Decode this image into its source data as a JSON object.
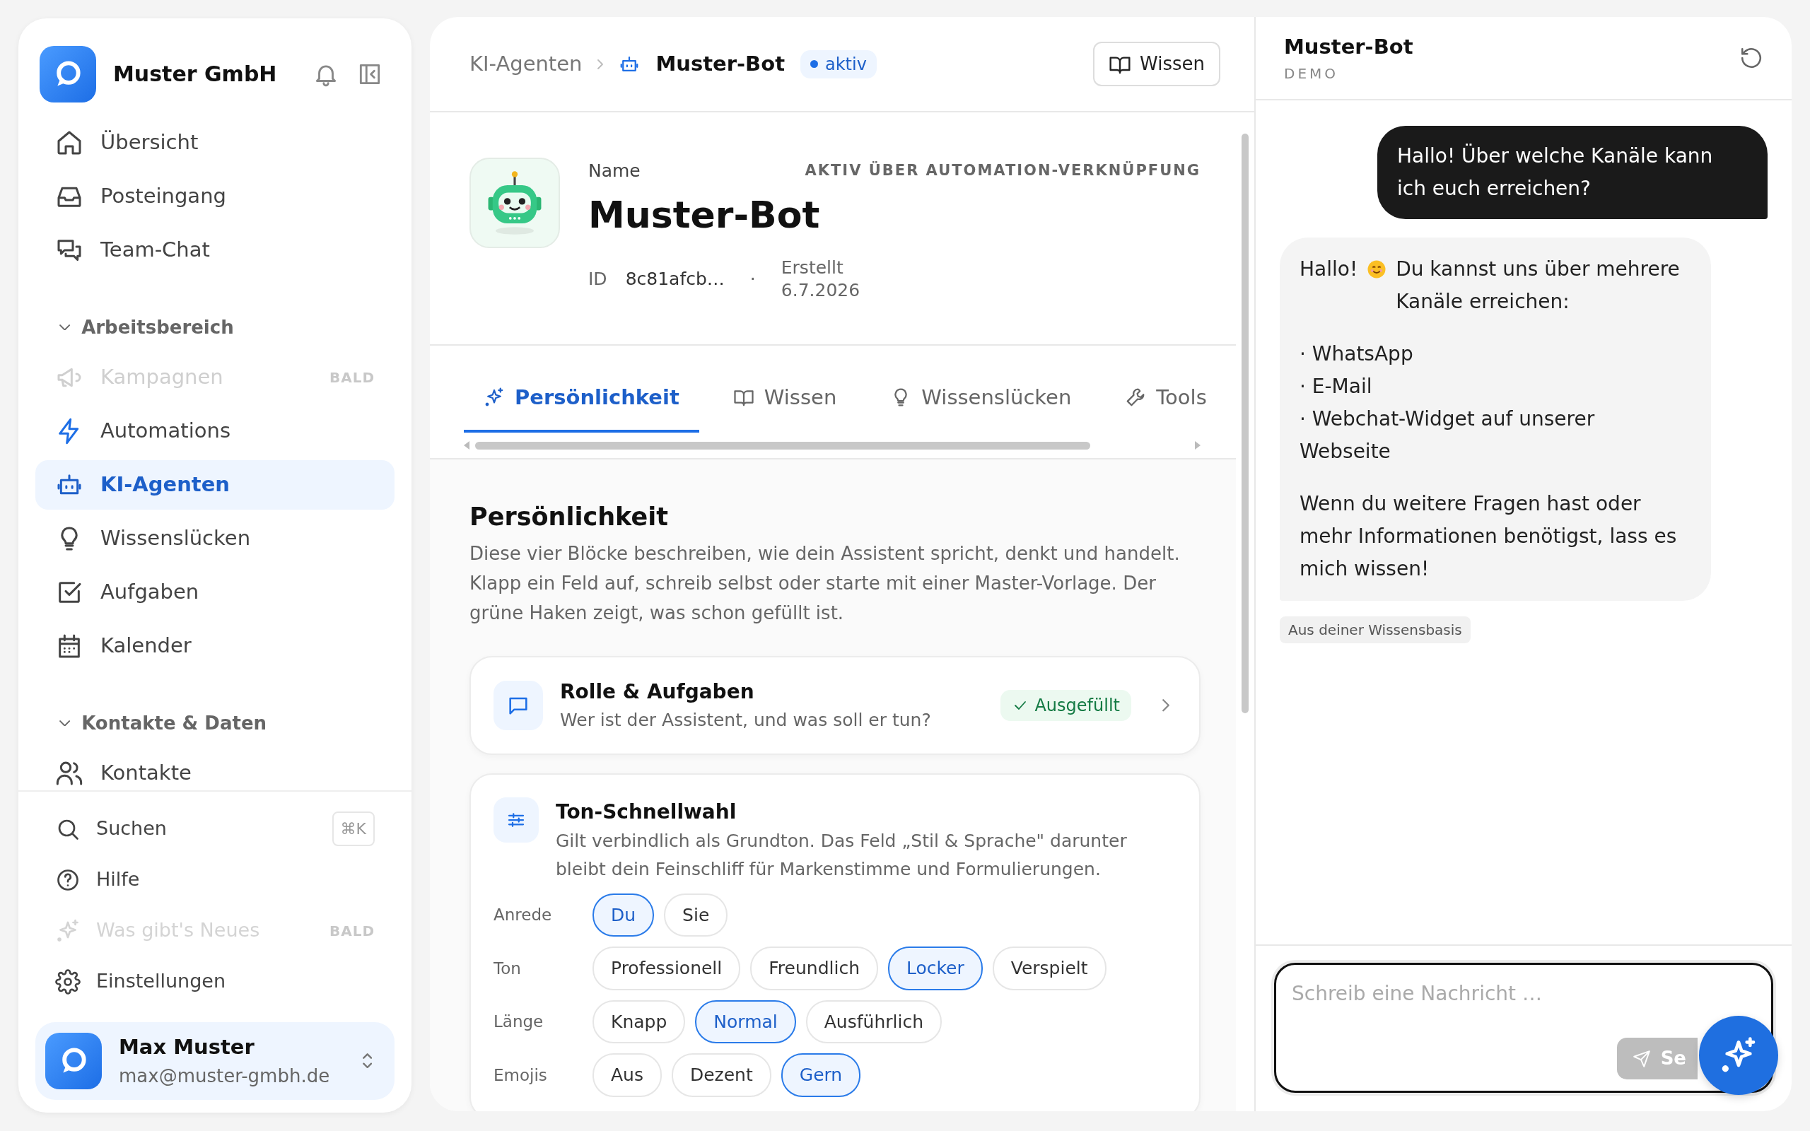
{
  "sidebar": {
    "brand": "Muster GmbH",
    "items": [
      {
        "kind": "link",
        "label": "Übersicht",
        "selected": false,
        "disabled": false
      },
      {
        "kind": "link",
        "label": "Posteingang",
        "selected": false,
        "disabled": false
      },
      {
        "kind": "link",
        "label": "Team-Chat",
        "selected": false,
        "disabled": false
      },
      {
        "kind": "section",
        "label": "Arbeitsbereich",
        "expanded": true
      },
      {
        "kind": "link",
        "label": "Kampagnen",
        "selected": false,
        "disabled": true,
        "badge": "BALD"
      },
      {
        "kind": "link",
        "label": "Automations",
        "selected": false,
        "disabled": false
      },
      {
        "kind": "link",
        "label": "KI-Agenten",
        "selected": true,
        "disabled": false
      },
      {
        "kind": "link",
        "label": "Wissenslücken",
        "selected": false,
        "disabled": false
      },
      {
        "kind": "link",
        "label": "Aufgaben",
        "selected": false,
        "disabled": false
      },
      {
        "kind": "link",
        "label": "Kalender",
        "selected": false,
        "disabled": false
      },
      {
        "kind": "section",
        "label": "Kontakte & Daten",
        "expanded": true
      },
      {
        "kind": "link",
        "label": "Kontakte",
        "selected": false,
        "disabled": false
      }
    ],
    "footer_items": [
      {
        "label": "Suchen",
        "shortcut": "⌘K",
        "disabled": false
      },
      {
        "label": "Hilfe",
        "disabled": false
      },
      {
        "label": "Was gibt's Neues",
        "disabled": true,
        "badge": "BALD"
      },
      {
        "label": "Einstellungen",
        "disabled": false
      }
    ],
    "user": {
      "name": "Max Muster",
      "email": "max@muster-gmbh.de"
    }
  },
  "main": {
    "breadcrumb": [
      "KI-Agenten",
      "Muster-Bot"
    ],
    "status": "aktiv",
    "header_button": "Wissen",
    "profile": {
      "name_label": "Name",
      "name": "Muster-Bot",
      "note": "AKTIV ÜBER AUTOMATION-VERKNÜPFUNG",
      "id_label": "ID",
      "id": "8c81afcb…",
      "separator": "·",
      "created_label": "Erstellt",
      "created": "6.7.2026"
    },
    "tabs": [
      {
        "label": "Persönlichkeit",
        "selected": true
      },
      {
        "label": "Wissen",
        "selected": false
      },
      {
        "label": "Wissenslücken",
        "selected": false
      },
      {
        "label": "Tools",
        "selected": false
      }
    ],
    "section": {
      "title": "Persönlichkeit",
      "description": "Diese vier Blöcke beschreiben, wie dein Assistent spricht, denkt und handelt. Klapp ein Feld auf, schreib selbst oder starte mit einer Master-Vorlage. Der grüne Haken zeigt, was schon gefüllt ist."
    },
    "role_card": {
      "title": "Rolle & Aufgaben",
      "subtitle": "Wer ist der Assistent, und was soll er tun?",
      "status": "Ausgefüllt",
      "filled": true
    },
    "tone_card": {
      "title": "Ton-Schnellwahl",
      "description": "Gilt verbindlich als Grundton. Das Feld „Stil & Sprache\" darunter bleibt dein Feinschliff für Markenstimme und Formulierungen.",
      "rows": [
        {
          "label": "Anrede",
          "options": [
            {
              "label": "Du",
              "selected": true
            },
            {
              "label": "Sie",
              "selected": false
            }
          ]
        },
        {
          "label": "Ton",
          "options": [
            {
              "label": "Professionell",
              "selected": false
            },
            {
              "label": "Freundlich",
              "selected": false
            },
            {
              "label": "Locker",
              "selected": true
            },
            {
              "label": "Verspielt",
              "selected": false
            }
          ]
        },
        {
          "label": "Länge",
          "options": [
            {
              "label": "Knapp",
              "selected": false
            },
            {
              "label": "Normal",
              "selected": true
            },
            {
              "label": "Ausführlich",
              "selected": false
            }
          ]
        },
        {
          "label": "Emojis",
          "options": [
            {
              "label": "Aus",
              "selected": false
            },
            {
              "label": "Dezent",
              "selected": false
            },
            {
              "label": "Gern",
              "selected": true
            }
          ]
        }
      ]
    }
  },
  "chat": {
    "title": "Muster-Bot",
    "subtitle": "DEMO",
    "messages": [
      {
        "kind": "user",
        "text": "Hallo! Über welche Kanäle kann ich euch erreichen?"
      },
      {
        "kind": "bot",
        "greeting": "Hallo!",
        "intro": "Du kannst uns über mehrere Kanäle erreichen:",
        "bullets": [
          "· WhatsApp",
          "· E-Mail",
          "· Webchat-Widget auf unserer Webseite"
        ],
        "closing": "Wenn du weitere Fragen hast oder mehr Informationen benötigst, lass es mich wissen!",
        "source": "Aus deiner Wissensbasis"
      }
    ],
    "composer": {
      "placeholder": "Schreib eine Nachricht …",
      "send_label": "Se"
    }
  }
}
